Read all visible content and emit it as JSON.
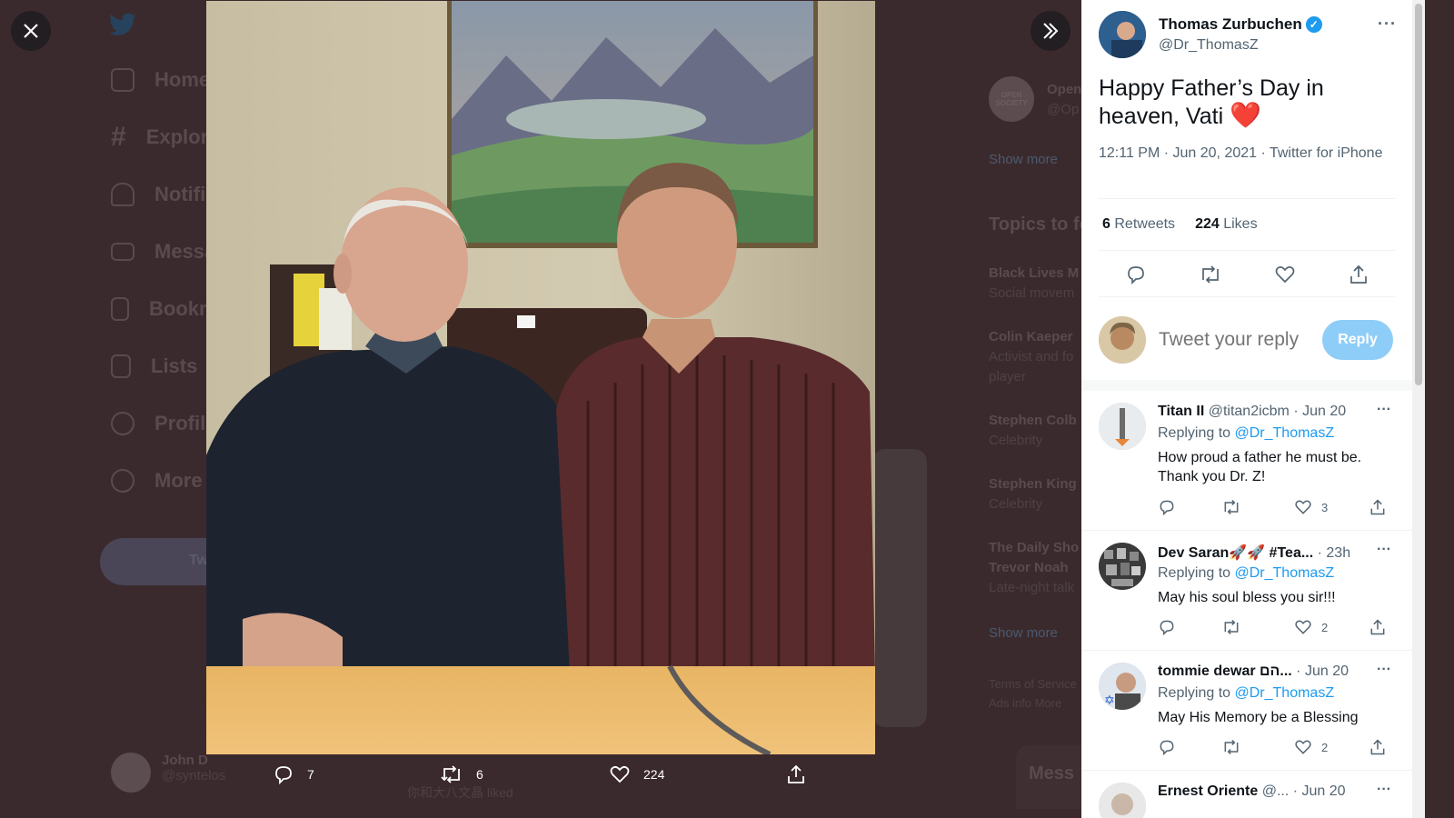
{
  "background": {
    "nav": [
      "Home",
      "Explore",
      "Notifications",
      "Messages",
      "Bookmarks",
      "Lists",
      "Profile",
      "More"
    ],
    "tweet_button": "Tweet",
    "user": {
      "name": "John D",
      "handle": "@syntelos"
    },
    "right": {
      "os_badge": "OPEN SOCIETY",
      "os_name": "Open",
      "os_handle": "@Op",
      "show_more_1": "Show more",
      "topics_title": "Topics to follow",
      "topics": [
        {
          "name": "Black Lives M",
          "sub": "Social movem"
        },
        {
          "name": "Colin Kaeper",
          "sub": "Activist and fo"
        },
        {
          "name": "Stephen Colb",
          "sub": "Celebrity"
        },
        {
          "name": "Stephen King",
          "sub": "Celebrity"
        },
        {
          "name": "The Daily Sho",
          "sub": "Trevor Noah"
        }
      ],
      "player": "player",
      "late_night": "Late-night talk",
      "show_more_2": "Show more",
      "footer_1": "Terms of Service",
      "footer_2": "Ads info   More",
      "messages": "Mess"
    },
    "liked_text": "你和大八文晶 liked"
  },
  "media_actions": {
    "replies": "7",
    "retweets": "6",
    "likes": "224"
  },
  "tweet": {
    "author_name": "Thomas Zurbuchen",
    "author_handle": "@Dr_ThomasZ",
    "text": "Happy Father’s Day in heaven, Vati",
    "emoji": "❤️",
    "meta": "12:11 PM · Jun 20, 2021 · Twitter for iPhone",
    "retweets_count": "6",
    "retweets_label": "Retweets",
    "likes_count": "224",
    "likes_label": "Likes",
    "more": "···"
  },
  "reply_box": {
    "placeholder": "Tweet your reply",
    "button": "Reply"
  },
  "replies": [
    {
      "name": "Titan II",
      "handle": "@titan2icbm",
      "time": "· Jun 20",
      "replying_label": "Replying to",
      "replying_to": "@Dr_ThomasZ",
      "text": "How proud a father he must be. Thank you Dr. Z!",
      "likes": "3"
    },
    {
      "name": "Dev Saran🚀🚀 #Tea...",
      "handle": "",
      "time": "· 23h",
      "replying_label": "Replying to",
      "replying_to": "@Dr_ThomasZ",
      "text": "May his soul bless you sir!!!",
      "likes": "2"
    },
    {
      "name": "tommie dewar הם...",
      "handle": "",
      "time": "· Jun 20",
      "replying_label": "Replying to",
      "replying_to": "@Dr_ThomasZ",
      "text": "May His Memory be a Blessing",
      "likes": "2"
    },
    {
      "name": "Ernest Oriente",
      "handle": "@...",
      "time": "· Jun 20",
      "replying_label": "",
      "replying_to": "",
      "text": "",
      "likes": ""
    }
  ],
  "colors": {
    "accent": "#1d9bf0",
    "reply_button": "#8ecdf8",
    "heart": "#e0162b",
    "overlay": "#3b2a2d"
  }
}
